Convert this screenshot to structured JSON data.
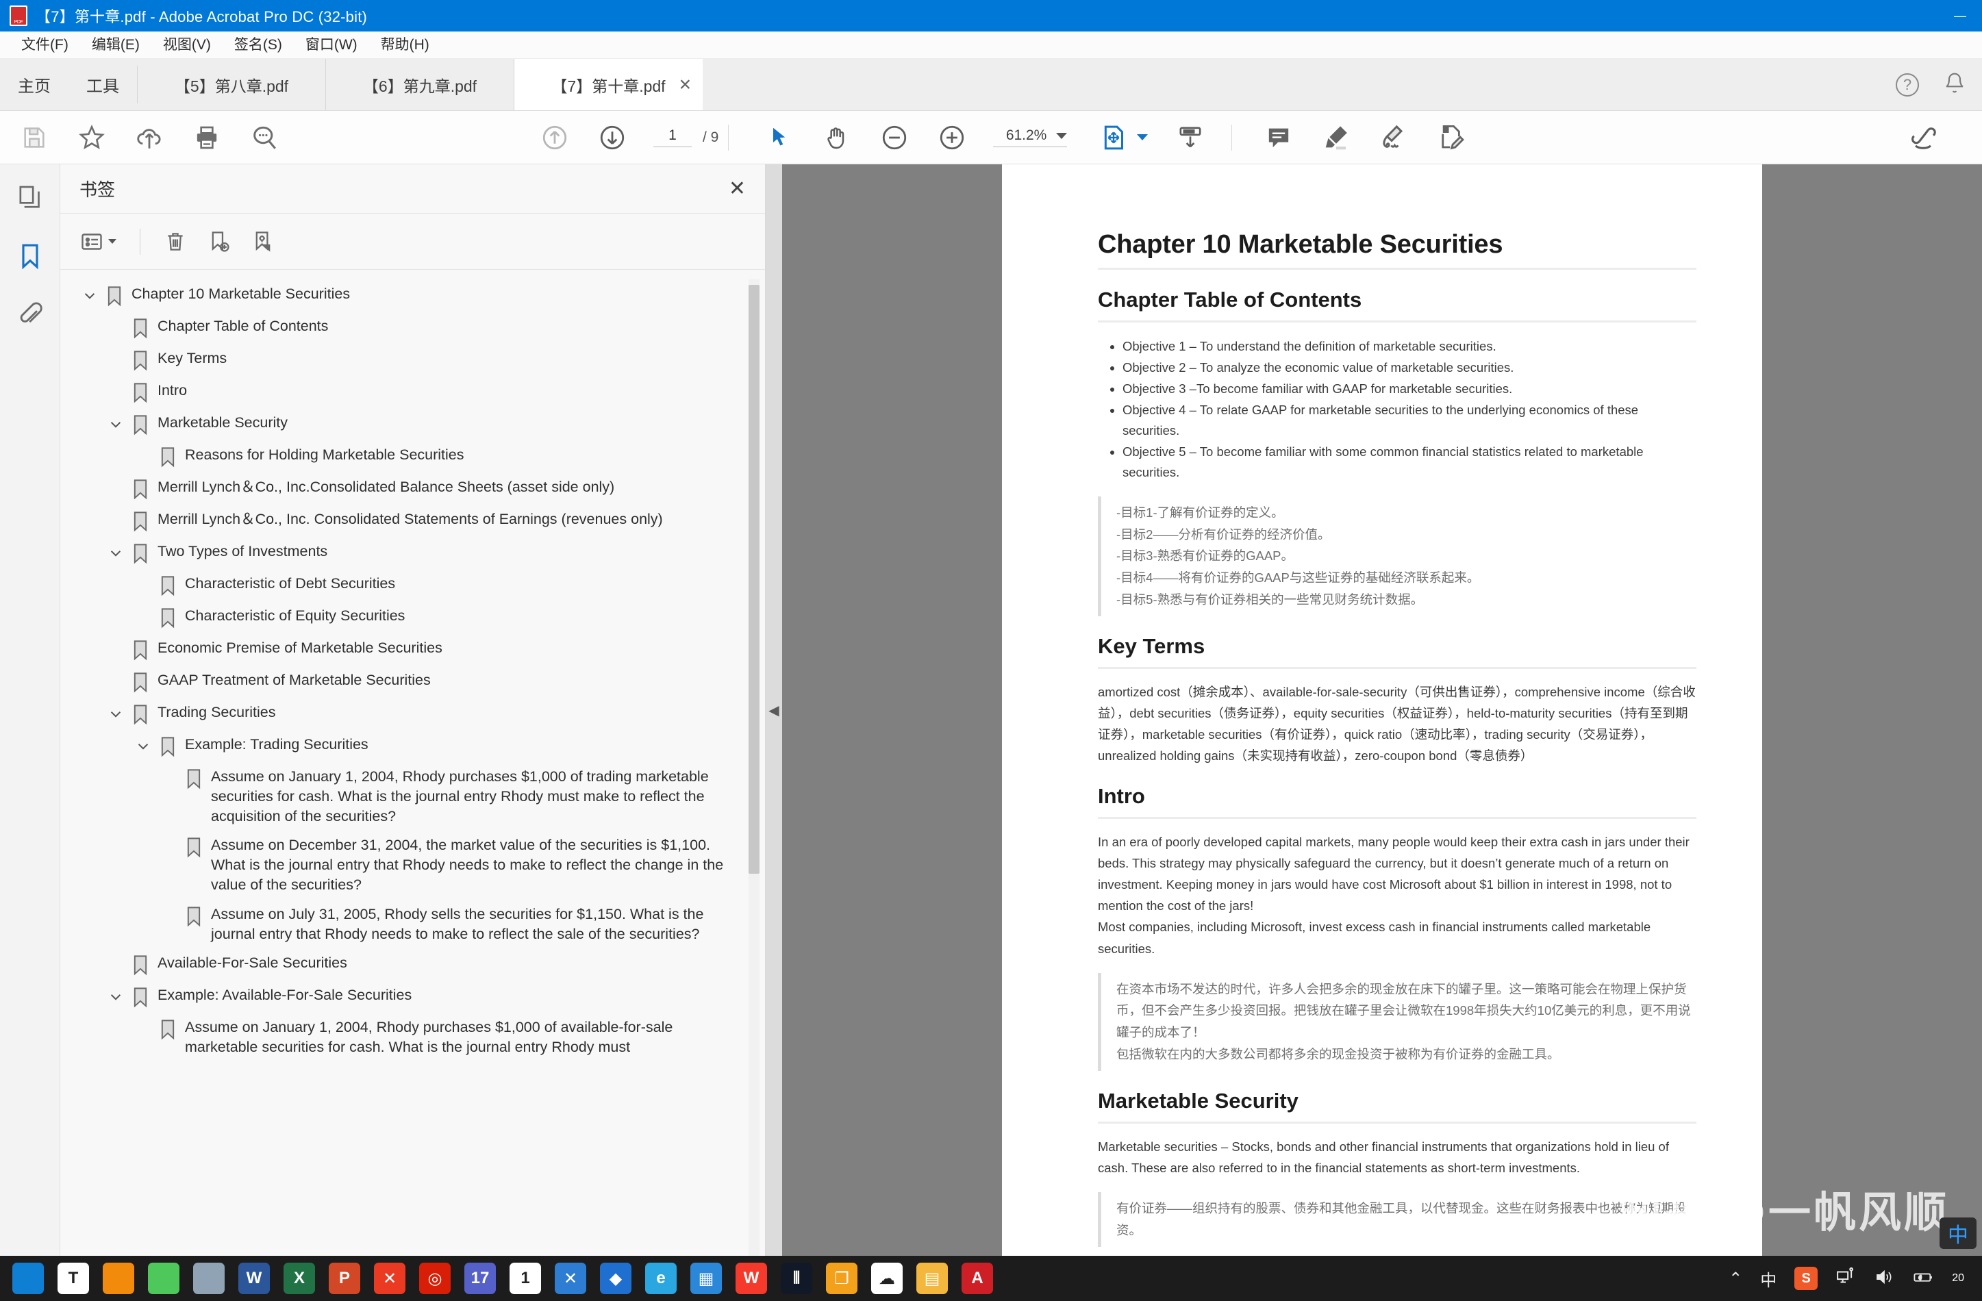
{
  "window": {
    "title": "【7】第十章.pdf - Adobe Acrobat Pro DC (32-bit)",
    "minimize_label": "—",
    "maximize_label": "▢",
    "close_label": "✕"
  },
  "menubar": {
    "items": [
      "文件(F)",
      "编辑(E)",
      "视图(V)",
      "签名(S)",
      "窗口(W)",
      "帮助(H)"
    ]
  },
  "tabbar": {
    "home_label": "主页",
    "tools_label": "工具",
    "docs": [
      {
        "label": "【5】第八章.pdf",
        "active": false
      },
      {
        "label": "【6】第九章.pdf",
        "active": false
      },
      {
        "label": "【7】第十章.pdf",
        "active": true
      }
    ],
    "close_label": "✕",
    "help_label": "?",
    "bell_label": "🔔"
  },
  "toolbar": {
    "save_label": "save-icon",
    "star_label": "star-icon",
    "upload_label": "upload-cloud-icon",
    "print_label": "print-icon",
    "search_label": "search-icon",
    "prev_page_label": "previous-page-icon",
    "next_page_label": "next-page-icon",
    "page_current": "1",
    "page_total": "/ 9",
    "select_label": "select-tool-icon",
    "hand_label": "hand-tool-icon",
    "zoom_out_label": "zoom-out-icon",
    "zoom_in_label": "zoom-in-icon",
    "zoom_value": "61.2%",
    "fit_page_label": "fit-page-icon",
    "scroll_mode_label": "scroll-mode-icon",
    "comment_label": "comment-icon",
    "highlight_label": "highlight-icon",
    "sign_label": "sign-icon",
    "edit_pdf_label": "edit-pdf-icon",
    "share_label": "share-icon"
  },
  "rail": {
    "pages_label": "page-thumbnails-icon",
    "bookmarks_label": "bookmarks-icon",
    "attachments_label": "attachments-icon"
  },
  "bookmarks_panel": {
    "title": "书签",
    "close_label": "✕",
    "options_label": "options-icon",
    "delete_label": "delete-bookmark-icon",
    "new_label": "new-bookmark-icon",
    "goto_label": "goto-bookmark-icon",
    "items": [
      {
        "level": 0,
        "expand": "down",
        "label": "Chapter 10 Marketable Securities"
      },
      {
        "level": 1,
        "expand": "none",
        "label": "Chapter Table of Contents"
      },
      {
        "level": 1,
        "expand": "none",
        "label": "Key Terms"
      },
      {
        "level": 1,
        "expand": "none",
        "label": "Intro"
      },
      {
        "level": 1,
        "expand": "down",
        "label": "Marketable Security"
      },
      {
        "level": 2,
        "expand": "none",
        "label": "Reasons for Holding Marketable Securities"
      },
      {
        "level": 1,
        "expand": "none",
        "label": "Merrill Lynch＆Co., Inc.Consolidated Balance Sheets (asset side only)"
      },
      {
        "level": 1,
        "expand": "none",
        "label": "Merrill Lynch＆Co., Inc. Consolidated  Statements of Earnings (revenues only)"
      },
      {
        "level": 1,
        "expand": "down",
        "label": "Two Types of Investments"
      },
      {
        "level": 2,
        "expand": "none",
        "label": "Characteristic of Debt Securities"
      },
      {
        "level": 2,
        "expand": "none",
        "label": "Characteristic of Equity Securities"
      },
      {
        "level": 1,
        "expand": "none",
        "label": "Economic Premise of Marketable Securities"
      },
      {
        "level": 1,
        "expand": "none",
        "label": "GAAP Treatment of Marketable Securities"
      },
      {
        "level": 1,
        "expand": "down",
        "label": "Trading Securities"
      },
      {
        "level": 2,
        "expand": "down",
        "label": "Example: Trading Securities"
      },
      {
        "level": 3,
        "expand": "none",
        "label": "Assume on January 1, 2004, Rhody purchases $1,000 of trading marketable securities for cash. What is the journal entry Rhody must make to reflect the acquisition of the securities?"
      },
      {
        "level": 3,
        "expand": "none",
        "label": "Assume on December 31, 2004, the market value of the securities is $1,100. What is the journal entry that Rhody needs to make to reflect the change in the value of the securities?"
      },
      {
        "level": 3,
        "expand": "none",
        "label": "Assume on July 31, 2005, Rhody sells the securities for $1,150. What is the journal entry that Rhody needs to make to reflect the sale of the securities?"
      },
      {
        "level": 1,
        "expand": "none",
        "label": "Available-For-Sale Securities"
      },
      {
        "level": 1,
        "expand": "down",
        "label": "Example: Available-For-Sale Securities"
      },
      {
        "level": 2,
        "expand": "none",
        "label": "Assume on January 1, 2004, Rhody purchases $1,000 of available-for-sale marketable securities for cash. What is the journal entry Rhody must"
      }
    ]
  },
  "document": {
    "h1": "Chapter 10 Marketable Securities",
    "toc_heading": "Chapter Table of Contents",
    "objectives": [
      "Objective 1 – To understand the definition of marketable securities.",
      "Objective 2 – To analyze the economic value of marketable securities.",
      "Objective 3 –To become familiar with GAAP for marketable securities.",
      "Objective 4 – To relate GAAP for marketable securities to the underlying economics of these securities.",
      "Objective 5 – To become familiar with some common financial statistics related to marketable securities."
    ],
    "objectives_cn": [
      "-目标1-了解有价证券的定义。",
      "-目标2——分析有价证券的经济价值。",
      "-目标3-熟悉有价证券的GAAP。",
      "-目标4——将有价证券的GAAP与这些证券的基础经济联系起来。",
      "-目标5-熟悉与有价证券相关的一些常见财务统计数据。"
    ],
    "key_terms_heading": "Key Terms",
    "key_terms_body": "amortized cost（摊余成本）、available-for-sale-security（可供出售证券），comprehensive income（综合收益），debt securities（债务证券），equity securities（权益证券），held-to-maturity securities（持有至到期证券），marketable securities（有价证券），quick ratio（速动比率），trading security（交易证券），unrealized holding gains（未实现持有收益），zero-coupon bond（零息债券）",
    "intro_heading": "Intro",
    "intro_p1": "In an era of poorly developed capital markets, many people would keep their extra cash in jars under their beds. This strategy may physically safeguard the currency, but it doesn’t generate much of a return on investment. Keeping money in jars would have cost Microsoft about $1 billion in interest in 1998, not to mention the cost of the jars!",
    "intro_p2": "Most companies, including Microsoft, invest excess cash in financial instruments called marketable securities.",
    "intro_cn_p1": "在资本市场不发达的时代，许多人会把多余的现金放在床下的罐子里。这一策略可能会在物理上保护货币，但不会产生多少投资回报。把钱放在罐子里会让微软在1998年损失大约10亿美元的利息，更不用说罐子的成本了！",
    "intro_cn_p2": "包括微软在内的大多数公司都将多余的现金投资于被称为有价证券的金融工具。",
    "ms_heading": "Marketable Security",
    "ms_body": "Marketable securities  – Stocks, bonds and other financial instruments that organizations hold in lieu of cash. These are also referred to in the financial statements as short-term investments.",
    "ms_cn": "有价证券——组织持有的股票、债券和其他金融工具，以代替现金。这些在财务报表中也被称为短期投资。",
    "watermark": "知乎 @一帆风顺"
  },
  "taskbar": {
    "apps": [
      {
        "name": "start",
        "glyph": "",
        "color": "#0f7fd4"
      },
      {
        "name": "typora",
        "glyph": "T",
        "color": "#ffffff"
      },
      {
        "name": "search",
        "glyph": "",
        "color": "#f28a0c"
      },
      {
        "name": "wechat",
        "glyph": "",
        "color": "#4ec75b"
      },
      {
        "name": "calculator",
        "glyph": "",
        "color": "#8fa3b5"
      },
      {
        "name": "word",
        "glyph": "W",
        "color": "#2b579a"
      },
      {
        "name": "excel",
        "glyph": "X",
        "color": "#217346"
      },
      {
        "name": "powerpoint",
        "glyph": "P",
        "color": "#d24726"
      },
      {
        "name": "xmind",
        "glyph": "✕",
        "color": "#eb3a22"
      },
      {
        "name": "netease-music",
        "glyph": "◎",
        "color": "#d81e06"
      },
      {
        "name": "calendar-17",
        "glyph": "17",
        "color": "#5560c9"
      },
      {
        "name": "onenote",
        "glyph": "1",
        "color": "#ffffff"
      },
      {
        "name": "vscode",
        "glyph": "✕",
        "color": "#2d7dd2"
      },
      {
        "name": "blocks",
        "glyph": "◆",
        "color": "#1f6fd0"
      },
      {
        "name": "edge",
        "glyph": "e",
        "color": "#2aa7e0"
      },
      {
        "name": "calendar",
        "glyph": "▦",
        "color": "#2b88d8"
      },
      {
        "name": "wps",
        "glyph": "W",
        "color": "#f5392b"
      },
      {
        "name": "pycharm",
        "glyph": "⫴",
        "color": "#111827"
      },
      {
        "name": "vmware",
        "glyph": "❐",
        "color": "#f3a01b"
      },
      {
        "name": "baidu-netdisk",
        "glyph": "☁",
        "color": "#ffffff"
      },
      {
        "name": "file-explorer",
        "glyph": "▤",
        "color": "#f2b73c"
      },
      {
        "name": "acrobat",
        "glyph": "A",
        "color": "#cf1f26"
      }
    ],
    "tray": {
      "chevron": "⌃",
      "ime": "中",
      "sogou": "S",
      "network": "network-icon",
      "volume": "volume-icon",
      "battery": "battery-icon",
      "clock_line1": "20"
    }
  }
}
